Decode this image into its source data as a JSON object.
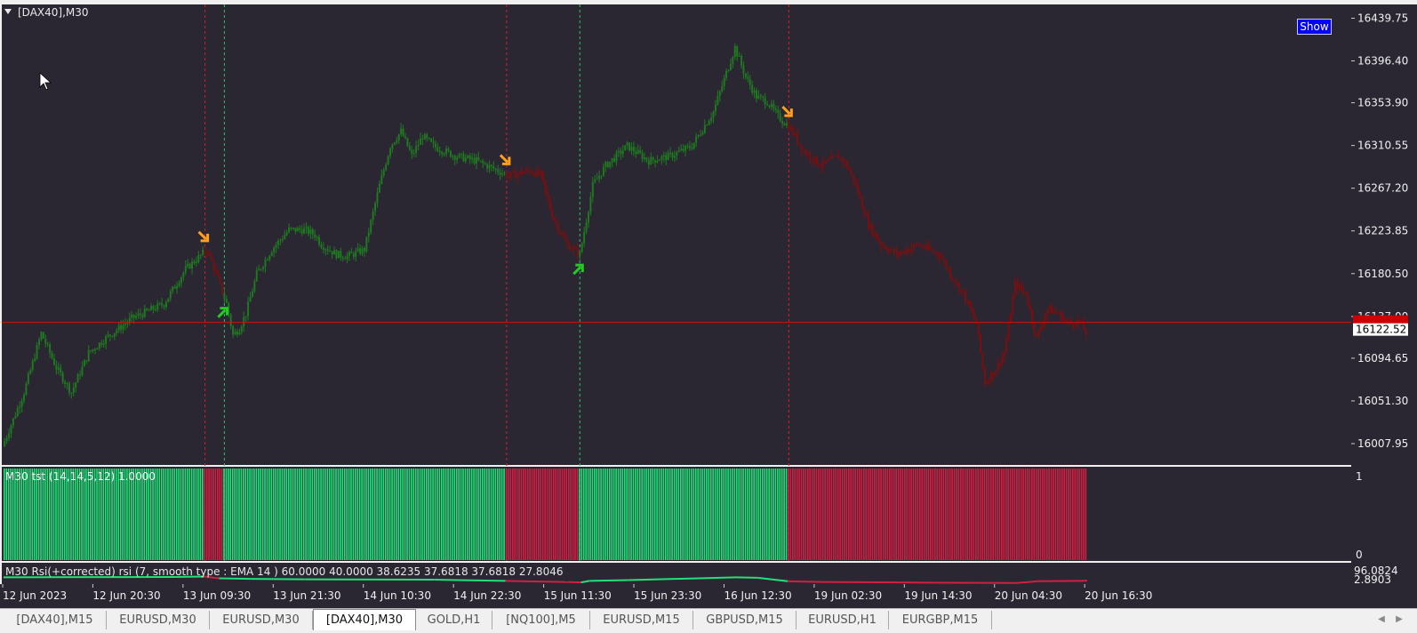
{
  "window": {
    "title": "[DAX40],M30"
  },
  "show_button": "Show",
  "colors": {
    "background": "#2a2733",
    "bull": "#1f7a1f",
    "bear": "#7a0f0f",
    "bar_green": "#22e07a",
    "bar_red": "#d01f43",
    "price_line": "#cc1111",
    "sell_arrow": "#ff9f1a",
    "buy_arrow": "#22cc22"
  },
  "icons": [
    "mouse-cursor-icon",
    "collapse-triangle-icon",
    "sell-arrow-icon",
    "buy-arrow-icon"
  ],
  "chart_data": [
    {
      "type": "candlestick",
      "title": "[DAX40],M30",
      "price_axis_ticks": [
        "16439.75",
        "16396.40",
        "16353.90",
        "16310.55",
        "16267.20",
        "16223.85",
        "16180.50",
        "16137.00",
        "16094.65",
        "16051.30",
        "16007.95"
      ],
      "ylim": [
        15989,
        16451
      ],
      "current_price": "16122.52",
      "current_price_level": 16131,
      "date_labels": [
        "12 Jun 2023",
        "12 Jun 20:30",
        "13 Jun 09:30",
        "13 Jun 21:30",
        "14 Jun 10:30",
        "14 Jun 22:30",
        "15 Jun 11:30",
        "15 Jun 23:30",
        "16 Jun 12:30",
        "19 Jun 02:30",
        "19 Jun 14:30",
        "20 Jun 04:30",
        "20 Jun 16:30"
      ],
      "price_path": [
        [
          0,
          16005
        ],
        [
          10,
          16060
        ],
        [
          18,
          16120
        ],
        [
          25,
          16085
        ],
        [
          32,
          16060
        ],
        [
          40,
          16100
        ],
        [
          48,
          16115
        ],
        [
          60,
          16135
        ],
        [
          75,
          16150
        ],
        [
          85,
          16185
        ],
        [
          95,
          16205
        ],
        [
          100,
          16175
        ],
        [
          104,
          16150
        ],
        [
          107,
          16118
        ],
        [
          110,
          16125
        ],
        [
          113,
          16140
        ],
        [
          118,
          16180
        ],
        [
          125,
          16205
        ],
        [
          133,
          16225
        ],
        [
          140,
          16225
        ],
        [
          145,
          16220
        ],
        [
          148,
          16210
        ],
        [
          155,
          16200
        ],
        [
          160,
          16198
        ],
        [
          168,
          16205
        ],
        [
          175,
          16270
        ],
        [
          180,
          16310
        ],
        [
          185,
          16325
        ],
        [
          190,
          16300
        ],
        [
          195,
          16320
        ],
        [
          200,
          16310
        ],
        [
          210,
          16300
        ],
        [
          220,
          16295
        ],
        [
          230,
          16285
        ],
        [
          235,
          16280
        ],
        [
          245,
          16285
        ],
        [
          250,
          16280
        ],
        [
          255,
          16240
        ],
        [
          262,
          16210
        ],
        [
          268,
          16200
        ],
        [
          274,
          16270
        ],
        [
          280,
          16290
        ],
        [
          290,
          16310
        ],
        [
          300,
          16295
        ],
        [
          310,
          16300
        ],
        [
          320,
          16310
        ],
        [
          330,
          16345
        ],
        [
          340,
          16410
        ],
        [
          345,
          16380
        ],
        [
          350,
          16360
        ],
        [
          355,
          16355
        ],
        [
          360,
          16340
        ],
        [
          365,
          16330
        ],
        [
          372,
          16305
        ],
        [
          380,
          16290
        ],
        [
          388,
          16300
        ],
        [
          392,
          16290
        ],
        [
          396,
          16270
        ],
        [
          402,
          16230
        ],
        [
          408,
          16210
        ],
        [
          415,
          16200
        ],
        [
          425,
          16210
        ],
        [
          435,
          16200
        ],
        [
          440,
          16180
        ],
        [
          446,
          16160
        ],
        [
          452,
          16130
        ],
        [
          456,
          16070
        ],
        [
          460,
          16080
        ],
        [
          465,
          16100
        ],
        [
          470,
          16170
        ],
        [
          475,
          16160
        ],
        [
          480,
          16115
        ],
        [
          485,
          16145
        ],
        [
          490,
          16140
        ],
        [
          495,
          16130
        ],
        [
          500,
          16132
        ],
        [
          503,
          16120
        ]
      ],
      "direction_bars": [
        {
          "signal": 1,
          "count": 93
        },
        {
          "signal": 0,
          "count": 9
        },
        {
          "signal": 1,
          "count": 131
        },
        {
          "signal": 0,
          "count": 34
        },
        {
          "signal": 1,
          "count": 97
        },
        {
          "signal": 0,
          "count": 139
        }
      ],
      "signals": [
        {
          "type": "sell",
          "bar": 93
        },
        {
          "type": "buy",
          "bar": 102
        },
        {
          "type": "sell",
          "bar": 233
        },
        {
          "type": "buy",
          "bar": 267
        },
        {
          "type": "sell",
          "bar": 364
        }
      ]
    },
    {
      "type": "bar",
      "title": "M30 tst (14,14,5,12) 1.0000",
      "ylim": [
        0,
        1
      ],
      "axis_ticks": [
        "1",
        "0"
      ]
    },
    {
      "type": "line",
      "title": "M30 Rsi(+corrected) rsi (7, smooth type : EMA  14 ) 60.0000 40.0000 38.6235 37.6818 37.6818 27.8046",
      "axis_ticks": [
        "96.0824",
        "2.8903"
      ],
      "ylim": [
        0,
        100
      ],
      "series": [
        {
          "name": "rsi",
          "x": [
            0,
            40,
            80,
            93,
            100,
            115,
            140,
            200,
            233,
            240,
            262,
            268,
            272,
            290,
            340,
            350,
            364,
            380,
            430,
            470,
            475,
            480,
            500,
            503
          ],
          "values": [
            30,
            31,
            32,
            34,
            25,
            22,
            20,
            18,
            12,
            10,
            6,
            4,
            12,
            16,
            30,
            28,
            10,
            6,
            3,
            1,
            5,
            10,
            12,
            13
          ]
        }
      ]
    }
  ]
}
